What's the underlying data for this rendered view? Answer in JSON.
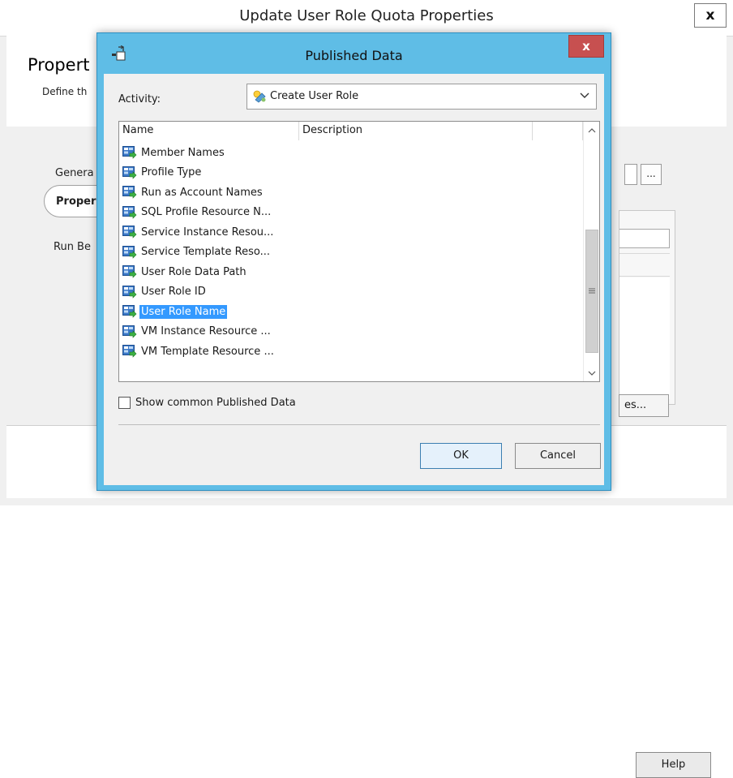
{
  "background_window": {
    "title": "Update User Role Quota Properties",
    "close_label": "x",
    "heading": "Propert",
    "subheading": "Define th",
    "nav": {
      "general": "Genera",
      "properties": "Proper",
      "run_behavior": "Run Be"
    },
    "ellipsis_label": "...",
    "properties_button": "es...",
    "help_button": "Help"
  },
  "dialog": {
    "title": "Published Data",
    "close_label": "x",
    "activity": {
      "label": "Activity:",
      "value": "Create User Role"
    },
    "list": {
      "columns": [
        "Name",
        "Description"
      ],
      "rows": [
        {
          "name": "Member Names"
        },
        {
          "name": "Profile Type"
        },
        {
          "name": "Run as Account Names"
        },
        {
          "name": "SQL Profile Resource N..."
        },
        {
          "name": "Service Instance Resou..."
        },
        {
          "name": "Service Template Reso..."
        },
        {
          "name": "User Role Data Path"
        },
        {
          "name": "User Role ID"
        },
        {
          "name": "User Role Name",
          "selected": true
        },
        {
          "name": "VM Instance Resource ..."
        },
        {
          "name": "VM Template Resource ..."
        }
      ]
    },
    "show_common_label": "Show common Published Data",
    "show_common_checked": false,
    "ok_label": "OK",
    "cancel_label": "Cancel"
  },
  "colors": {
    "dialog_frame": "#5fbde6",
    "selection": "#3399ff",
    "close_button": "#c75050"
  },
  "icons": {
    "dialog_icon": "published-data-icon",
    "activity_icon": "runbook-activity-icon",
    "row_icon": "published-data-item-icon"
  }
}
